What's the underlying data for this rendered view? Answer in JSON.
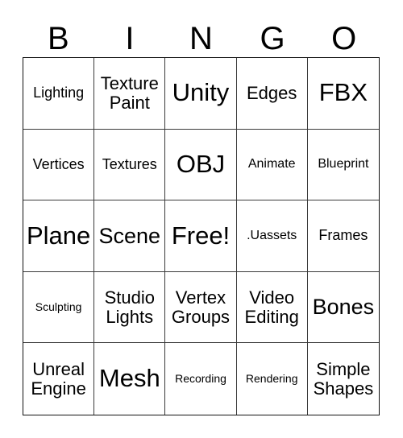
{
  "card": {
    "title": "BINGO",
    "header_letters": [
      "B",
      "I",
      "N",
      "G",
      "O"
    ],
    "border_color": "#111111",
    "grid_line_color": "#3a3a3a",
    "background_color": "#ffffff",
    "text_color": "#000000",
    "rows": 5,
    "columns": 5,
    "free_space": "Free!",
    "cells": [
      {
        "text": "Lighting",
        "size": "sm"
      },
      {
        "text": "Texture Paint",
        "size": "md"
      },
      {
        "text": "Unity",
        "size": "xl"
      },
      {
        "text": "Edges",
        "size": "md"
      },
      {
        "text": "FBX",
        "size": "xl"
      },
      {
        "text": "Vertices",
        "size": "sm"
      },
      {
        "text": "Textures",
        "size": "sm"
      },
      {
        "text": "OBJ",
        "size": "xl"
      },
      {
        "text": "Animate",
        "size": "xs"
      },
      {
        "text": "Blueprint",
        "size": "xs"
      },
      {
        "text": "Plane",
        "size": "xl"
      },
      {
        "text": "Scene",
        "size": "lg"
      },
      {
        "text": "Free!",
        "size": "xl"
      },
      {
        "text": ".Uassets",
        "size": "xs"
      },
      {
        "text": "Frames",
        "size": "sm"
      },
      {
        "text": "Sculpting",
        "size": "xxs"
      },
      {
        "text": "Studio Lights",
        "size": "md"
      },
      {
        "text": "Vertex Groups",
        "size": "md"
      },
      {
        "text": "Video Editing",
        "size": "md"
      },
      {
        "text": "Bones",
        "size": "lg"
      },
      {
        "text": "Unreal Engine",
        "size": "md"
      },
      {
        "text": "Mesh",
        "size": "xl"
      },
      {
        "text": "Recording",
        "size": "xxs"
      },
      {
        "text": "Rendering",
        "size": "xxs"
      },
      {
        "text": "Simple Shapes",
        "size": "md"
      }
    ]
  }
}
